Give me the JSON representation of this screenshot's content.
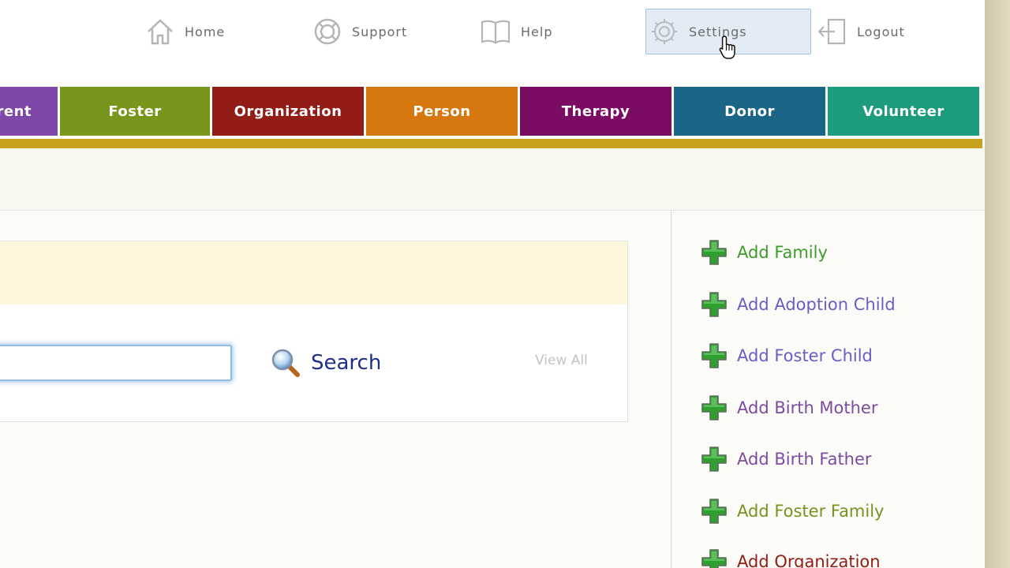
{
  "top_nav": {
    "home": "Home",
    "support": "Support",
    "help": "Help",
    "settings": "Settings",
    "logout": "Logout"
  },
  "tabs": [
    {
      "label": "rent",
      "color": "#7f48a8"
    },
    {
      "label": "Foster",
      "color": "#77961b"
    },
    {
      "label": "Organization",
      "color": "#921c16"
    },
    {
      "label": "Person",
      "color": "#d6780f"
    },
    {
      "label": "Therapy",
      "color": "#7a0c63"
    },
    {
      "label": "Donor",
      "color": "#1b6586"
    },
    {
      "label": "Volunteer",
      "color": "#1d9b7d"
    }
  ],
  "search": {
    "input_value": "",
    "button_label": "Search",
    "view_all": "View All"
  },
  "add_menu": [
    {
      "label": "Add Family",
      "color": "#3f9a2e"
    },
    {
      "label": "Add Adoption Child",
      "color": "#6e5cc6"
    },
    {
      "label": "Add Foster Child",
      "color": "#6e5cc6"
    },
    {
      "label": "Add Birth Mother",
      "color": "#7d4aa0"
    },
    {
      "label": "Add Birth Father",
      "color": "#7d4aa0"
    },
    {
      "label": "Add Foster Family",
      "color": "#76921f"
    },
    {
      "label": "Add Organization",
      "color": "#921c16"
    }
  ],
  "colors": {
    "gold_bar": "#c9a21c",
    "plus_icon": "#2fa02f",
    "search_text": "#1e2f86"
  }
}
